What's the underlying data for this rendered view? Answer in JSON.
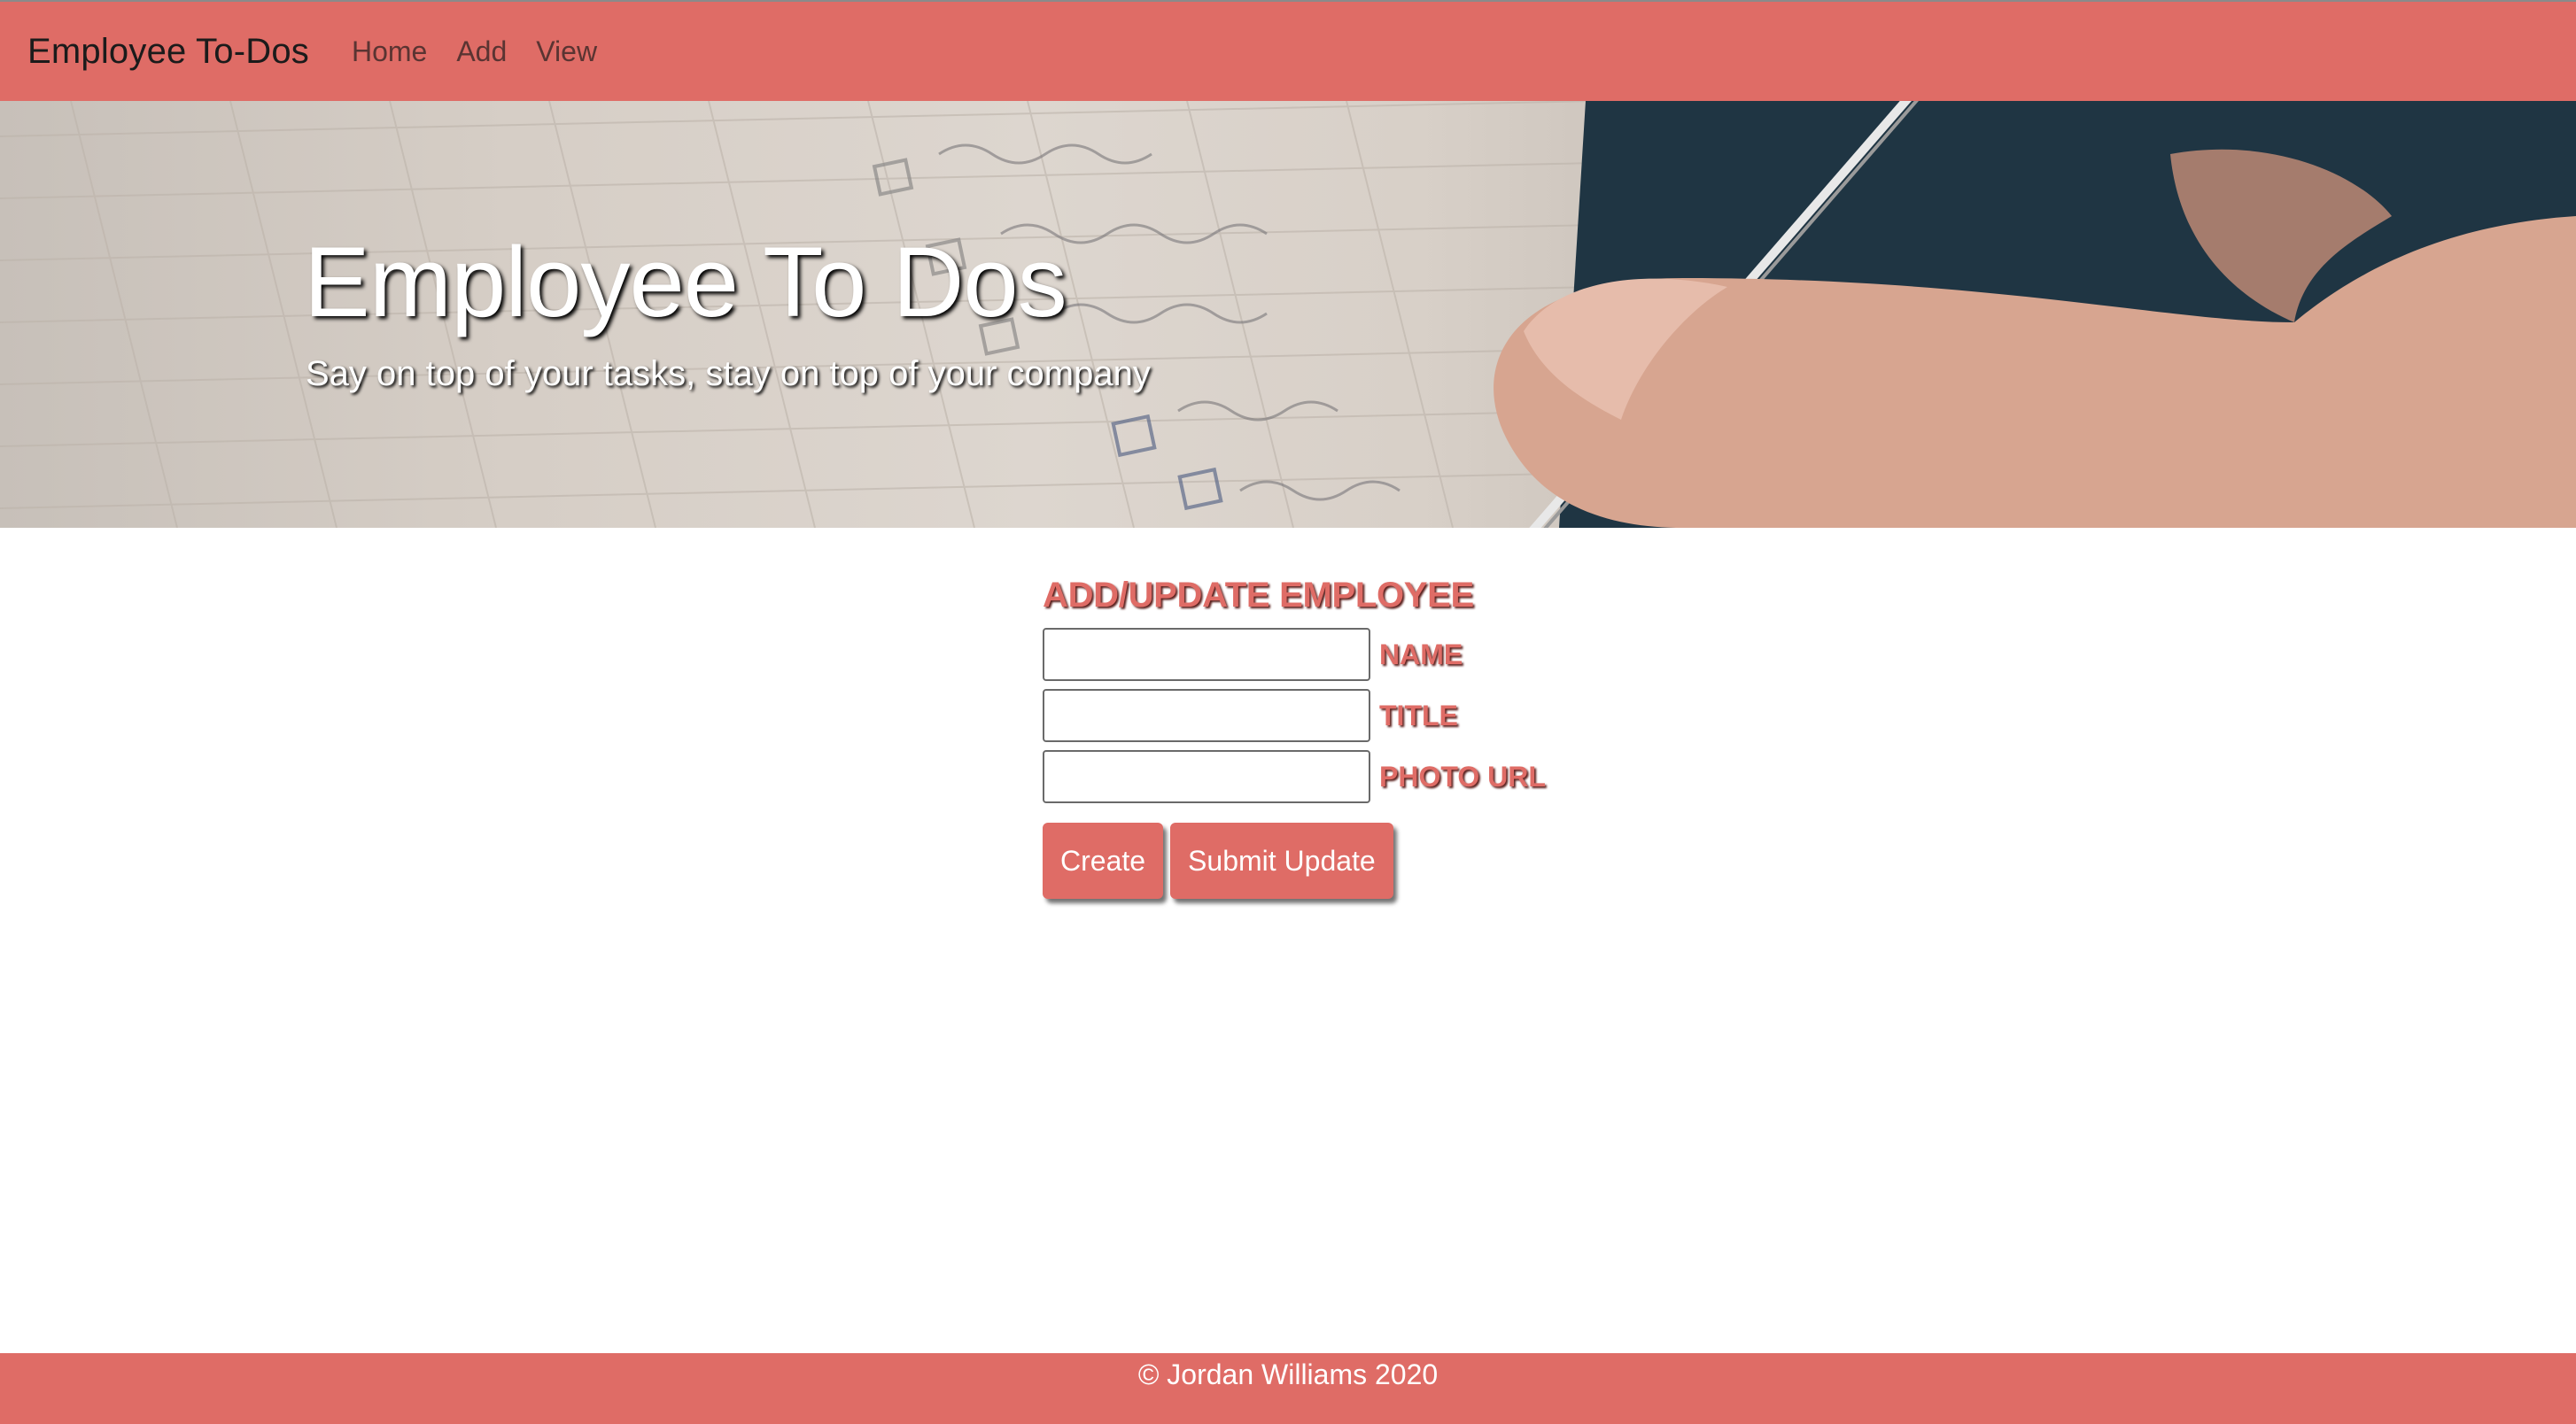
{
  "navbar": {
    "brand": "Employee To-Dos",
    "links": [
      "Home",
      "Add",
      "View"
    ]
  },
  "hero": {
    "title": "Employee To Dos",
    "subtitle": "Say on top of your tasks, stay on top of your company"
  },
  "form": {
    "heading": "ADD/UPDATE EMPLOYEE",
    "fields": [
      {
        "label": "NAME",
        "value": ""
      },
      {
        "label": "TITLE",
        "value": ""
      },
      {
        "label": "PHOTO URL",
        "value": ""
      }
    ],
    "create_label": "Create",
    "update_label": "Submit Update"
  },
  "footer": {
    "text": "© Jordan Williams 2020"
  },
  "colors": {
    "accent": "#df6c66",
    "white": "#ffffff"
  }
}
